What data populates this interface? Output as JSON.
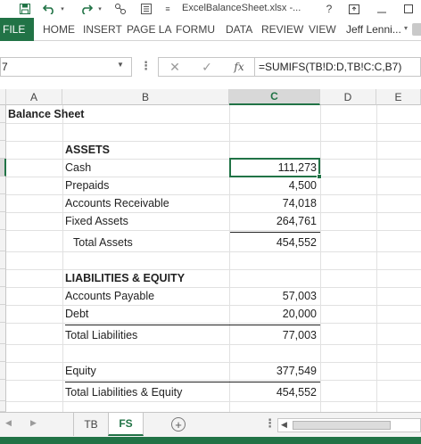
{
  "window": {
    "title": "ExcelBalanceSheet.xlsx -...",
    "help_label": "?",
    "accent_color": "#217346"
  },
  "ribbon": {
    "file_label": "FILE",
    "tabs": [
      "HOME",
      "INSERT",
      "PAGE LA",
      "FORMU",
      "DATA",
      "REVIEW",
      "VIEW"
    ],
    "user_name": "Jeff Lenni..."
  },
  "formula_bar": {
    "name_box": "7",
    "fx_label": "fx",
    "formula": "=SUMIFS(TB!D:D,TB!C:C,B7)"
  },
  "sheet": {
    "columns": [
      "A",
      "B",
      "C",
      "D",
      "E"
    ],
    "selected_column": "C",
    "title": "Balance Sheet",
    "assets_header": "ASSETS",
    "assets": [
      {
        "label": "Cash",
        "value": "111,273"
      },
      {
        "label": "Prepaids",
        "value": "4,500"
      },
      {
        "label": "Accounts Receivable",
        "value": "74,018"
      },
      {
        "label": "Fixed Assets",
        "value": "264,761"
      }
    ],
    "total_assets": {
      "label": "Total Assets",
      "value": "454,552"
    },
    "liabilities_header": "LIABILITIES & EQUITY",
    "liabilities": [
      {
        "label": "Accounts Payable",
        "value": "57,003"
      },
      {
        "label": "Debt",
        "value": "20,000"
      }
    ],
    "total_liabilities": {
      "label": "Total Liabilities",
      "value": "77,003"
    },
    "equity": {
      "label": "Equity",
      "value": "377,549"
    },
    "total_liabilities_equity": {
      "label": "Total Liabilities & Equity",
      "value": "454,552"
    }
  },
  "sheet_tabs": {
    "tabs": [
      "TB",
      "FS"
    ],
    "active": "FS"
  }
}
